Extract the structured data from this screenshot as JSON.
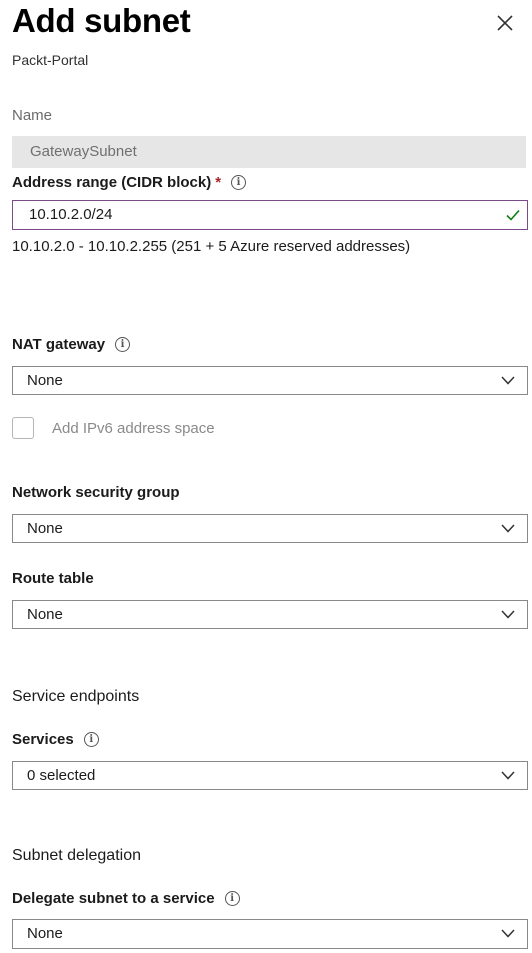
{
  "panel": {
    "title": "Add subnet",
    "subtitle": "Packt-Portal"
  },
  "name": {
    "label": "Name",
    "value": "GatewaySubnet"
  },
  "address_range": {
    "label": "Address range (CIDR block)",
    "required_marker": "*",
    "value": "10.10.2.0/24",
    "hint": "10.10.2.0 - 10.10.2.255 (251 + 5 Azure reserved addresses)"
  },
  "nat_gateway": {
    "label": "NAT gateway",
    "value": "None"
  },
  "ipv6": {
    "label": "Add IPv6 address space",
    "checked": false
  },
  "nsg": {
    "label": "Network security group",
    "value": "None"
  },
  "route_table": {
    "label": "Route table",
    "value": "None"
  },
  "service_endpoints": {
    "heading": "Service endpoints",
    "services_label": "Services",
    "services_value": "0 selected"
  },
  "subnet_delegation": {
    "heading": "Subnet delegation",
    "delegate_label": "Delegate subnet to a service",
    "delegate_value": "None"
  },
  "icons": {
    "info": "i",
    "close": "close-icon",
    "chevron": "chevron-down-icon",
    "valid": "checkmark-icon"
  },
  "colors": {
    "focus_border": "#7a4b86",
    "valid_check": "#107c10",
    "required": "#a4262c",
    "readonly_bg": "#e6e6e6"
  }
}
